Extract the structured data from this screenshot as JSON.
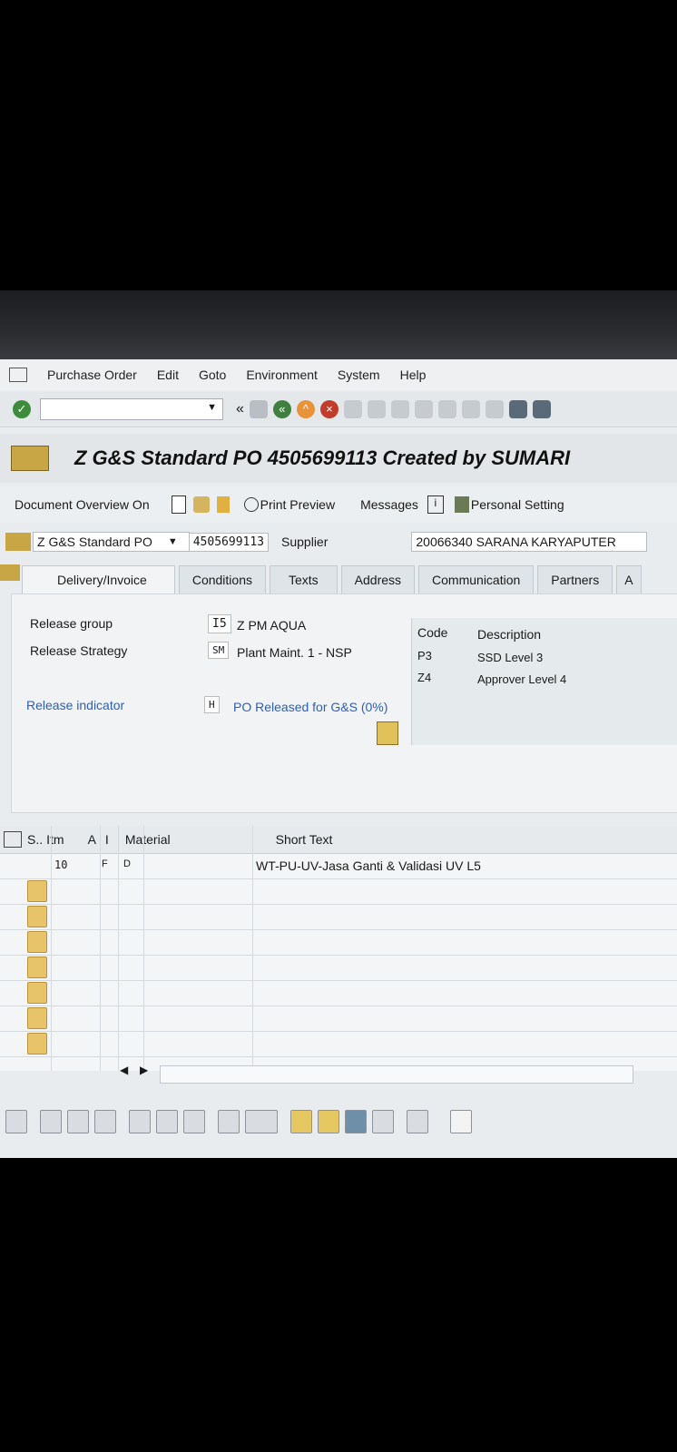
{
  "menu": [
    "Purchase Order",
    "Edit",
    "Goto",
    "Environment",
    "System",
    "Help"
  ],
  "toolbar": {
    "back_label": "«"
  },
  "title": "Z G&S Standard PO 4505699113 Created by SUMARI",
  "app_toolbar": {
    "doc_overview": "Document Overview On",
    "print_preview": "Print Preview",
    "messages": "Messages",
    "personal_setting": "Personal Setting"
  },
  "header": {
    "doc_type": "Z G&S Standard PO",
    "po_number": "4505699113",
    "supplier_label": "Supplier",
    "supplier_value": "20066340 SARANA KARYAPUTER"
  },
  "tabs": [
    "Delivery/Invoice",
    "Conditions",
    "Texts",
    "Address",
    "Communication",
    "Partners",
    "A"
  ],
  "release": {
    "group_label": "Release group",
    "group_code": "I5",
    "group_desc": "Z PM AQUA",
    "strategy_label": "Release Strategy",
    "strategy_code": "SM",
    "strategy_desc": "Plant Maint. 1 - NSP",
    "indicator_label": "Release indicator",
    "indicator_code": "H",
    "indicator_desc": "PO Released for G&S (0%)"
  },
  "release_table": {
    "col_code": "Code",
    "col_desc": "Description",
    "rows": [
      {
        "code": "P3",
        "desc": "SSD Level 3"
      },
      {
        "code": "Z4",
        "desc": "Approver Level 4"
      }
    ]
  },
  "items": {
    "headers": {
      "s": "S..",
      "itm": "Itm",
      "a": "A",
      "i": "I",
      "material": "Material",
      "short_text": "Short Text"
    },
    "rows": [
      {
        "itm": "10",
        "a": "F",
        "i": "D",
        "short_text": "WT-PU-UV-Jasa Ganti & Validasi UV L5"
      }
    ]
  }
}
